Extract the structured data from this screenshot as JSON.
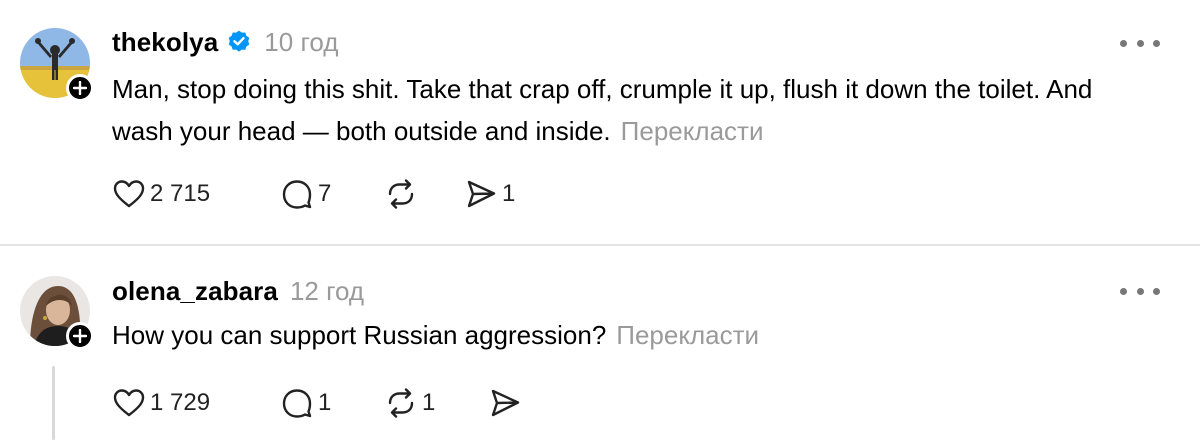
{
  "posts": [
    {
      "username": "thekolya",
      "verified": true,
      "time": "10 год",
      "text": "Man, stop doing this shit. Take that crap off, crumple it up, flush it down the toilet. And wash your head — both outside and inside.",
      "translate_label": "Перекласти",
      "likes": "2 715",
      "replies": "7",
      "reposts": "",
      "shares": "1"
    },
    {
      "username": "olena_zabara",
      "verified": false,
      "time": "12 год",
      "text": "How you can support Russian aggression?",
      "translate_label": "Перекласти",
      "likes": "1 729",
      "replies": "1",
      "reposts": "1",
      "shares": ""
    }
  ],
  "colors": {
    "verified_blue": "#0095f6",
    "muted_text": "#9a9a9a",
    "divider": "#e3e3e3"
  },
  "icons": [
    "heart-icon",
    "comment-icon",
    "repost-icon",
    "share-icon",
    "more-icon",
    "follow-plus-icon",
    "verified-badge-icon"
  ]
}
